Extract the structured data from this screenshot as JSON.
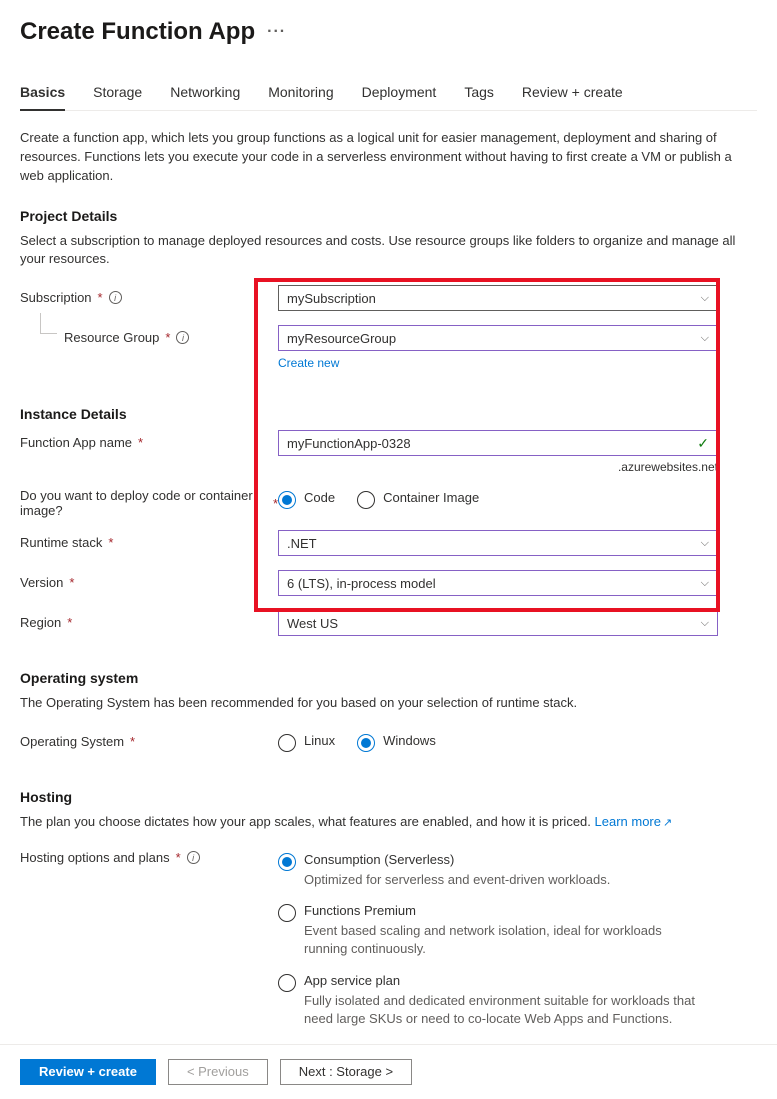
{
  "header": {
    "title": "Create Function App",
    "ellipsis": "···"
  },
  "tabs": [
    {
      "label": "Basics",
      "active": true
    },
    {
      "label": "Storage"
    },
    {
      "label": "Networking"
    },
    {
      "label": "Monitoring"
    },
    {
      "label": "Deployment"
    },
    {
      "label": "Tags"
    },
    {
      "label": "Review + create"
    }
  ],
  "intro": "Create a function app, which lets you group functions as a logical unit for easier management, deployment and sharing of resources. Functions lets you execute your code in a serverless environment without having to first create a VM or publish a web application.",
  "projectDetails": {
    "heading": "Project Details",
    "desc": "Select a subscription to manage deployed resources and costs. Use resource groups like folders to organize and manage all your resources.",
    "subscriptionLabel": "Subscription",
    "subscriptionValue": "mySubscription",
    "resourceGroupLabel": "Resource Group",
    "resourceGroupValue": "myResourceGroup",
    "createNew": "Create new"
  },
  "instanceDetails": {
    "heading": "Instance Details",
    "nameLabel": "Function App name",
    "nameValue": "myFunctionApp-0328",
    "domainSuffix": ".azurewebsites.net",
    "deployLabel": "Do you want to deploy code or container image?",
    "deployOptions": [
      {
        "label": "Code",
        "selected": true
      },
      {
        "label": "Container Image",
        "selected": false
      }
    ],
    "runtimeLabel": "Runtime stack",
    "runtimeValue": ".NET",
    "versionLabel": "Version",
    "versionValue": "6 (LTS), in-process model",
    "regionLabel": "Region",
    "regionValue": "West US"
  },
  "os": {
    "heading": "Operating system",
    "desc": "The Operating System has been recommended for you based on your selection of runtime stack.",
    "label": "Operating System",
    "options": [
      {
        "label": "Linux",
        "selected": false
      },
      {
        "label": "Windows",
        "selected": true
      }
    ]
  },
  "hosting": {
    "heading": "Hosting",
    "desc": "The plan you choose dictates how your app scales, what features are enabled, and how it is priced. ",
    "learnMore": "Learn more",
    "label": "Hosting options and plans",
    "options": [
      {
        "label": "Consumption (Serverless)",
        "desc": "Optimized for serverless and event-driven workloads.",
        "selected": true
      },
      {
        "label": "Functions Premium",
        "desc": "Event based scaling and network isolation, ideal for workloads running continuously.",
        "selected": false
      },
      {
        "label": "App service plan",
        "desc": "Fully isolated and dedicated environment suitable for workloads that need large SKUs or need to co-locate Web Apps and Functions.",
        "selected": false
      }
    ]
  },
  "footer": {
    "reviewCreate": "Review + create",
    "prev": "< Previous",
    "next": "Next : Storage >"
  }
}
